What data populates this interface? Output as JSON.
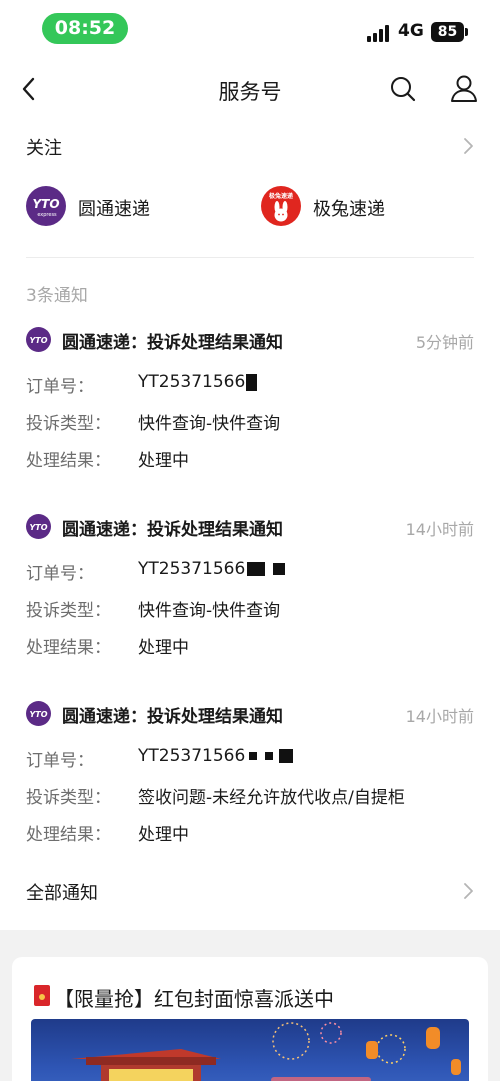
{
  "status": {
    "time": "08:52",
    "network": "4G",
    "battery": "85"
  },
  "nav": {
    "title": "服务号"
  },
  "follow": {
    "title": "关注",
    "accounts": [
      {
        "name": "圆通速递",
        "logo_text": "YTO",
        "logo_sub": "express",
        "color": "#5b2a86"
      },
      {
        "name": "极兔速递",
        "logo_text": "极兔速递",
        "color": "#e0261f"
      }
    ]
  },
  "notices_count": "3条通知",
  "notifications": [
    {
      "title": "圆通速递：投诉处理结果通知",
      "time": "5分钟前",
      "order_label": "订单号：",
      "order_value": "YT25371566",
      "type_label": "投诉类型：",
      "type_value": "快件查询-快件查询",
      "result_label": "处理结果：",
      "result_value": "处理中"
    },
    {
      "title": "圆通速递：投诉处理结果通知",
      "time": "14小时前",
      "order_label": "订单号：",
      "order_value": "YT25371566",
      "type_label": "投诉类型：",
      "type_value": "快件查询-快件查询",
      "result_label": "处理结果：",
      "result_value": "处理中"
    },
    {
      "title": "圆通速递：投诉处理结果通知",
      "time": "14小时前",
      "order_label": "订单号：",
      "order_value": "YT25371566",
      "type_label": "投诉类型：",
      "type_value": "签收问题-未经允许放代收点/自提柜",
      "result_label": "处理结果：",
      "result_value": "处理中"
    }
  ],
  "all_notices": "全部通知",
  "promo": {
    "title": "【限量抢】红包封面惊喜派送中"
  },
  "colors": {
    "status_green": "#34c759",
    "yto_purple": "#5b2a86",
    "jitu_red": "#e0261f",
    "muted": "#a8a8a8"
  }
}
